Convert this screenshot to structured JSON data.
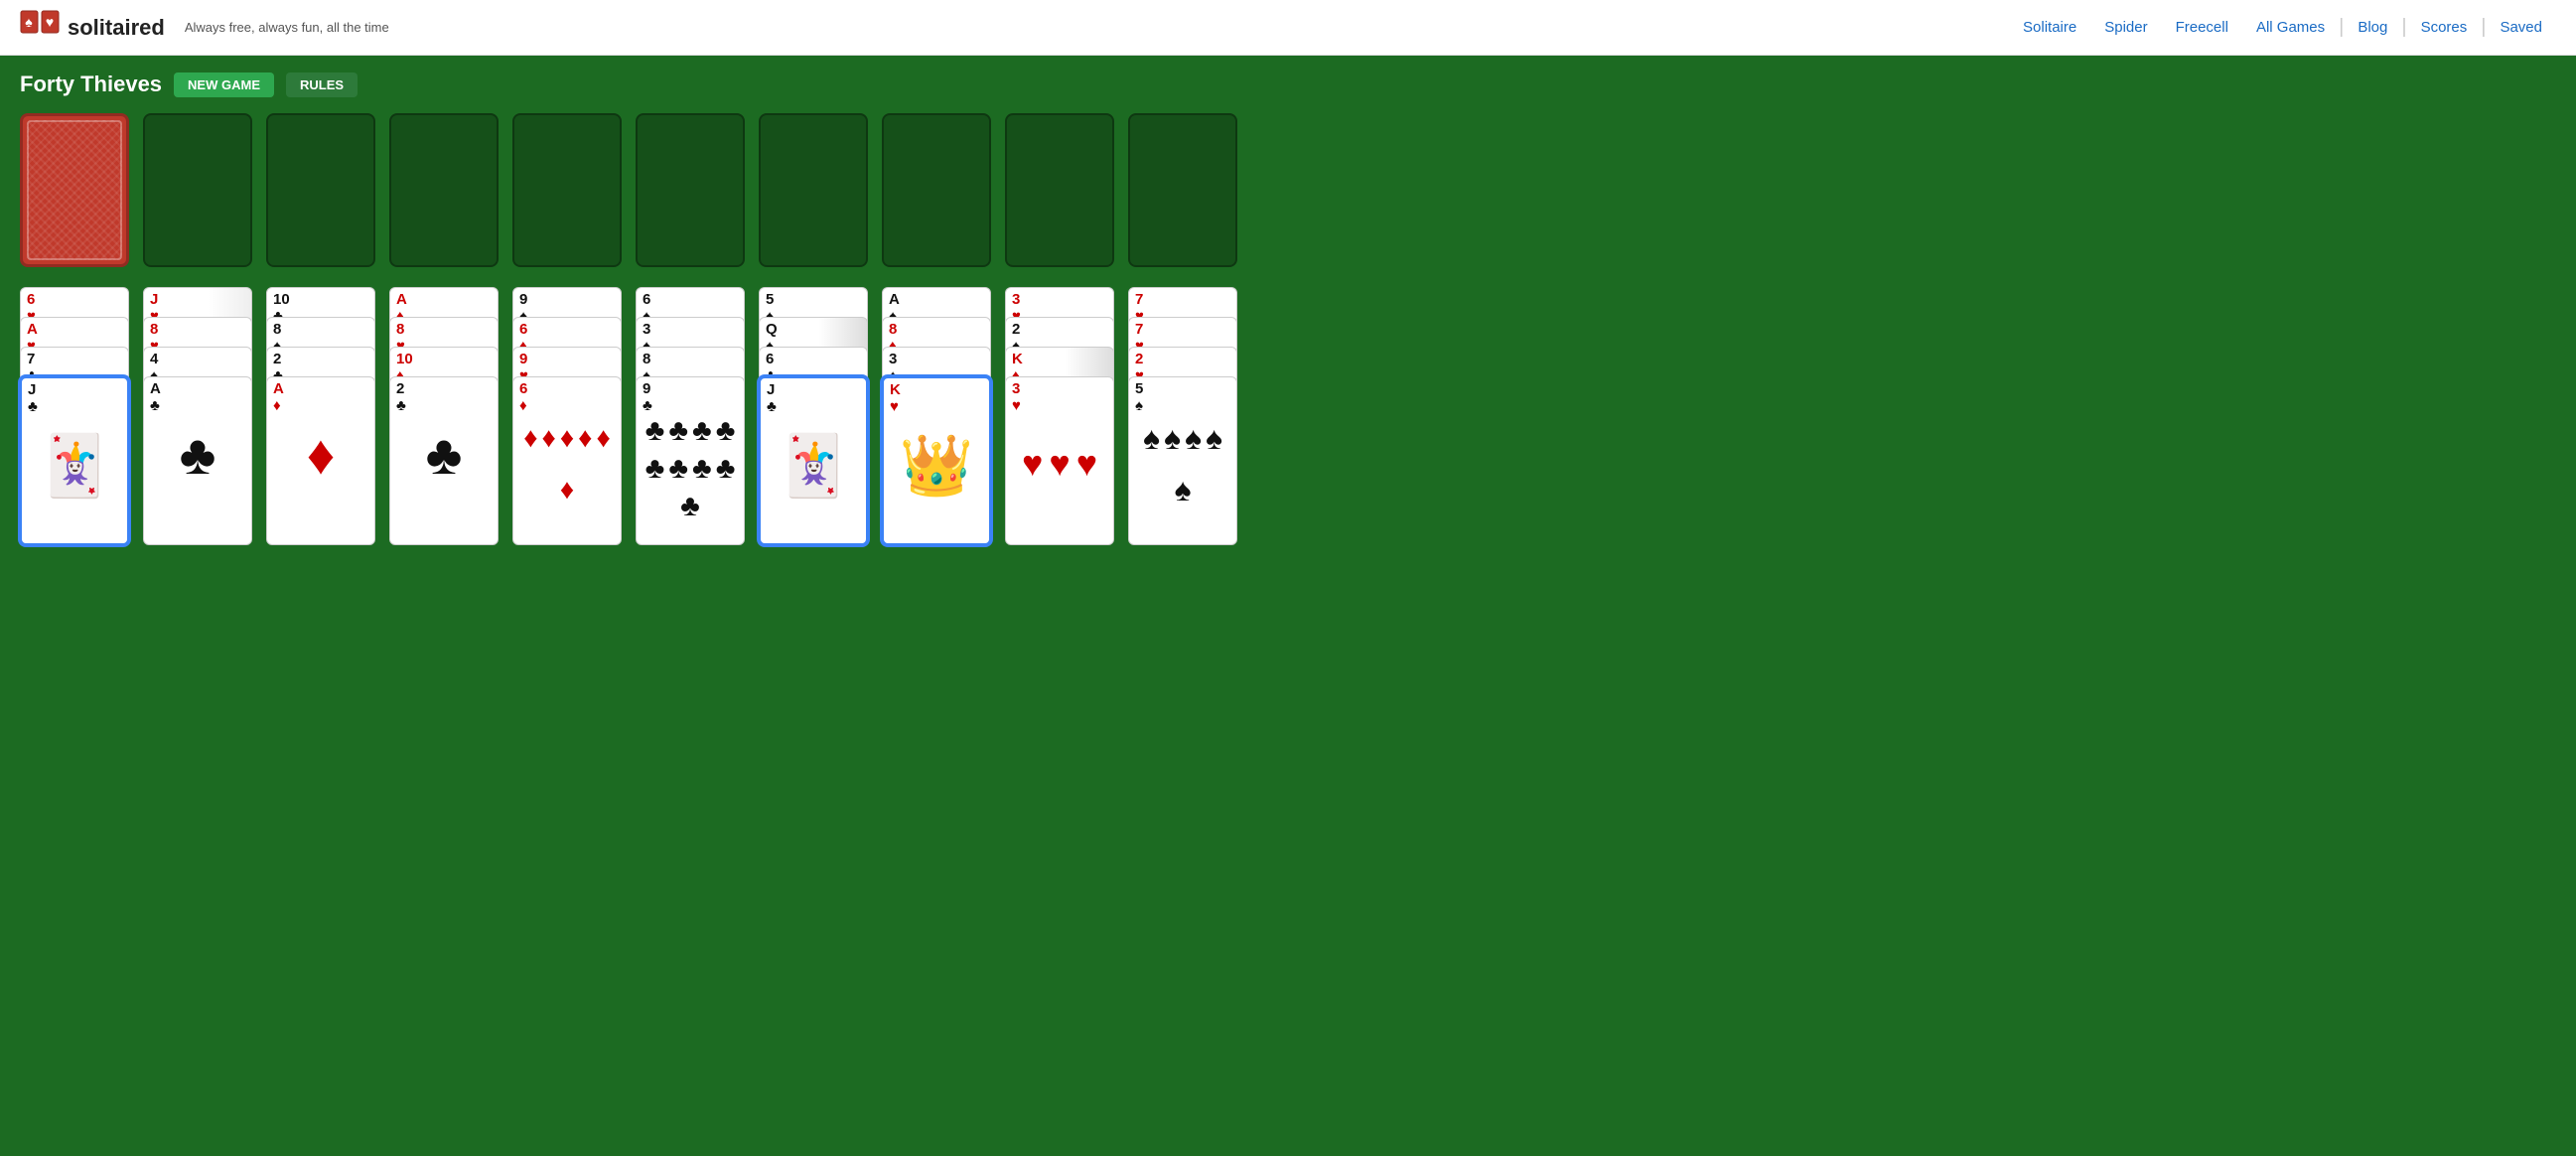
{
  "header": {
    "logo_text": "solitaired",
    "tagline": "Always free, always fun, all the time",
    "nav_items": [
      {
        "label": "Solitaire",
        "id": "nav-solitaire"
      },
      {
        "label": "Spider",
        "id": "nav-spider"
      },
      {
        "label": "Freecell",
        "id": "nav-freecell"
      },
      {
        "label": "All Games",
        "id": "nav-all-games"
      },
      {
        "label": "Blog",
        "id": "nav-blog"
      },
      {
        "label": "Scores",
        "id": "nav-scores"
      },
      {
        "label": "Saved",
        "id": "nav-saved"
      }
    ]
  },
  "game": {
    "title": "Forty Thieves",
    "new_game_label": "NEW GAME",
    "rules_label": "RULES",
    "foundation_count": 8,
    "columns": [
      {
        "id": "col-1",
        "cards": [
          {
            "rank": "6",
            "suit": "♥",
            "color": "red",
            "symbol": "♥"
          },
          {
            "rank": "A",
            "suit": "♥",
            "color": "red",
            "symbol": "♥"
          },
          {
            "rank": "7",
            "suit": "♣",
            "color": "black",
            "symbol": "♣"
          },
          {
            "rank": "J",
            "suit": "♣",
            "color": "black",
            "symbol": "♣",
            "bottom": true,
            "selected": true
          }
        ]
      },
      {
        "id": "col-2",
        "cards": [
          {
            "rank": "J",
            "suit": "♥",
            "color": "red",
            "symbol": "♥",
            "has_card_behind": true
          },
          {
            "rank": "8",
            "suit": "♥",
            "color": "red",
            "symbol": "♥"
          },
          {
            "rank": "4",
            "suit": "♠",
            "color": "black",
            "symbol": "♠"
          },
          {
            "rank": "A",
            "suit": "♣",
            "color": "black",
            "symbol": "♣",
            "bottom": true
          }
        ]
      },
      {
        "id": "col-3",
        "cards": [
          {
            "rank": "10",
            "suit": "♣",
            "color": "black",
            "symbol": "♣"
          },
          {
            "rank": "8",
            "suit": "♠",
            "color": "black",
            "symbol": "♠"
          },
          {
            "rank": "2",
            "suit": "♣",
            "color": "black",
            "symbol": "♣"
          },
          {
            "rank": "A",
            "suit": "♦",
            "color": "red",
            "symbol": "♦",
            "bottom": true
          }
        ]
      },
      {
        "id": "col-4",
        "cards": [
          {
            "rank": "A",
            "suit": "♦",
            "color": "red",
            "symbol": "♦"
          },
          {
            "rank": "8",
            "suit": "♥",
            "color": "red",
            "symbol": "♥"
          },
          {
            "rank": "10",
            "suit": "♦",
            "color": "red",
            "symbol": "♦"
          },
          {
            "rank": "2",
            "suit": "♣",
            "color": "black",
            "symbol": "♣",
            "bottom": true
          }
        ]
      },
      {
        "id": "col-5",
        "cards": [
          {
            "rank": "9",
            "suit": "♠",
            "color": "black",
            "symbol": "♠"
          },
          {
            "rank": "6",
            "suit": "♦",
            "color": "red",
            "symbol": "♦"
          },
          {
            "rank": "9",
            "suit": "♥",
            "color": "red",
            "symbol": "♥"
          },
          {
            "rank": "6",
            "suit": "♦",
            "color": "red",
            "symbol": "♦",
            "bottom": true
          }
        ]
      },
      {
        "id": "col-6",
        "cards": [
          {
            "rank": "6",
            "suit": "♠",
            "color": "black",
            "symbol": "♠"
          },
          {
            "rank": "3",
            "suit": "♠",
            "color": "black",
            "symbol": "♠"
          },
          {
            "rank": "8",
            "suit": "♠",
            "color": "black",
            "symbol": "♠"
          },
          {
            "rank": "9",
            "suit": "♣",
            "color": "black",
            "symbol": "♣",
            "bottom": true
          }
        ]
      },
      {
        "id": "col-7",
        "cards": [
          {
            "rank": "5",
            "suit": "♠",
            "color": "black",
            "symbol": "♠"
          },
          {
            "rank": "Q",
            "suit": "♠",
            "color": "black",
            "symbol": "♠",
            "has_card_behind": true
          },
          {
            "rank": "6",
            "suit": "♣",
            "color": "black",
            "symbol": "♣"
          },
          {
            "rank": "J",
            "suit": "♣",
            "color": "black",
            "symbol": "♣",
            "bottom": true,
            "selected": true
          }
        ]
      },
      {
        "id": "col-8",
        "cards": [
          {
            "rank": "A",
            "suit": "♠",
            "color": "black",
            "symbol": "♠"
          },
          {
            "rank": "8",
            "suit": "♦",
            "color": "red",
            "symbol": "♦"
          },
          {
            "rank": "3",
            "suit": "♠",
            "color": "black",
            "symbol": "♠"
          },
          {
            "rank": "K",
            "suit": "♥",
            "color": "red",
            "symbol": "♥",
            "bottom": true,
            "selected": true
          }
        ]
      },
      {
        "id": "col-9",
        "cards": [
          {
            "rank": "3",
            "suit": "♥",
            "color": "red",
            "symbol": "♥"
          },
          {
            "rank": "2",
            "suit": "♠",
            "color": "black",
            "symbol": "♠"
          },
          {
            "rank": "K",
            "suit": "♦",
            "color": "red",
            "symbol": "♦",
            "has_card_behind": true
          },
          {
            "rank": "3",
            "suit": "♥",
            "color": "red",
            "symbol": "♥",
            "bottom": true
          }
        ]
      },
      {
        "id": "col-10",
        "cards": [
          {
            "rank": "7",
            "suit": "♥",
            "color": "red",
            "symbol": "♥"
          },
          {
            "rank": "7",
            "suit": "♥",
            "color": "red",
            "symbol": "♥"
          },
          {
            "rank": "2",
            "suit": "♥",
            "color": "red",
            "symbol": "♥"
          },
          {
            "rank": "5",
            "suit": "♠",
            "color": "black",
            "symbol": "♠",
            "bottom": true
          }
        ]
      }
    ]
  }
}
